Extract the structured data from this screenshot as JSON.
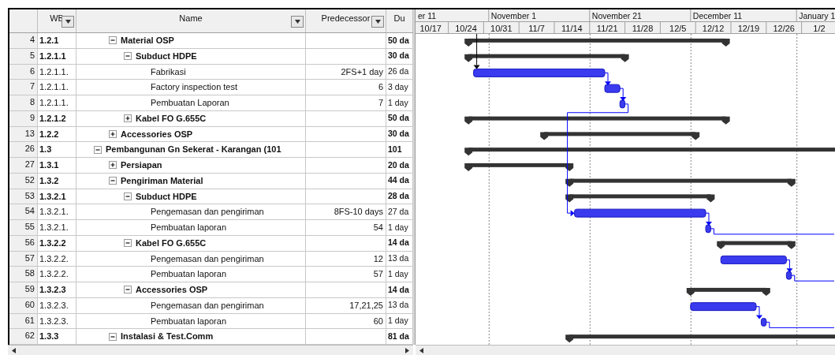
{
  "table": {
    "columns": [
      {
        "label": "WB",
        "filter": true
      },
      {
        "label": "Name",
        "filter": true
      },
      {
        "label": "Predecessor",
        "filter": true
      },
      {
        "label": "Du",
        "filter": false
      }
    ]
  },
  "tasks": [
    {
      "children": [
        {
          "id": "4",
          "wbs": "1.2.1",
          "summary": true,
          "name": "Material OSP",
          "duration": "50 da",
          "expanded": true,
          "children": [
            {
              "id": "5",
              "wbs": "1.2.1.1",
              "summary": true,
              "name": "Subduct HDPE",
              "duration": "30 da",
              "expanded": true,
              "children": [
                {
                  "id": "6",
                  "wbs": "1.2.1.1.",
                  "summary": false,
                  "name": "Fabrikasi",
                  "predecessors": "2FS+1 day",
                  "duration": "26 da"
                },
                {
                  "id": "7",
                  "wbs": "1.2.1.1.",
                  "summary": false,
                  "name": "Factory inspection test",
                  "predecessors": "6",
                  "duration": "3 day"
                },
                {
                  "id": "8",
                  "wbs": "1.2.1.1.",
                  "summary": false,
                  "name": "Pembuatan Laporan",
                  "predecessors": "7",
                  "duration": "1 day"
                }
              ]
            },
            {
              "id": "9",
              "wbs": "1.2.1.2",
              "summary": true,
              "name": "Kabel FO G.655C",
              "duration": "50 da",
              "expanded": false
            }
          ]
        },
        {
          "id": "13",
          "wbs": "1.2.2",
          "summary": true,
          "name": "Accessories OSP",
          "duration": "30 da",
          "expanded": false
        }
      ]
    },
    {
      "id": "26",
      "wbs": "1.3",
      "summary": true,
      "name": "Pembangunan Gn Sekerat - Karangan (101",
      "duration": "101",
      "expanded": true,
      "children": [
        {
          "id": "27",
          "wbs": "1.3.1",
          "summary": true,
          "name": "Persiapan",
          "duration": "20 da",
          "expanded": false
        },
        {
          "id": "52",
          "wbs": "1.3.2",
          "summary": true,
          "name": "Pengiriman Material",
          "duration": "44 da",
          "expanded": true,
          "children": [
            {
              "id": "53",
              "wbs": "1.3.2.1",
              "summary": true,
              "name": "Subduct HDPE",
              "duration": "28 da",
              "expanded": true,
              "children": [
                {
                  "id": "54",
                  "wbs": "1.3.2.1.",
                  "summary": false,
                  "name": "Pengemasan dan pengiriman",
                  "predecessors": "8FS-10 days",
                  "duration": "27 da"
                },
                {
                  "id": "55",
                  "wbs": "1.3.2.1.",
                  "summary": false,
                  "name": "Pembuatan laporan",
                  "predecessors": "54",
                  "duration": "1 day"
                }
              ]
            },
            {
              "id": "56",
              "wbs": "1.3.2.2",
              "summary": true,
              "name": "Kabel FO G.655C",
              "duration": "14 da",
              "expanded": true,
              "children": [
                {
                  "id": "57",
                  "wbs": "1.3.2.2.",
                  "summary": false,
                  "name": "Pengemasan dan pengiriman",
                  "predecessors": "12",
                  "duration": "13 da"
                },
                {
                  "id": "58",
                  "wbs": "1.3.2.2.",
                  "summary": false,
                  "name": "Pembuatan laporan",
                  "predecessors": "57",
                  "duration": "1 day"
                }
              ]
            },
            {
              "id": "59",
              "wbs": "1.3.2.3",
              "summary": true,
              "name": "Accessories OSP",
              "duration": "14 da",
              "expanded": true,
              "children": [
                {
                  "id": "60",
                  "wbs": "1.3.2.3.",
                  "summary": false,
                  "name": "Pengemasan dan pengiriman",
                  "predecessors": "17,21,25",
                  "duration": "13 da"
                },
                {
                  "id": "61",
                  "wbs": "1.3.2.3.",
                  "summary": false,
                  "name": "Pembuatan laporan",
                  "predecessors": "60",
                  "duration": "1 day"
                }
              ]
            }
          ]
        },
        {
          "id": "62",
          "wbs": "1.3.3",
          "summary": true,
          "name": "Instalasi & Test.Comm",
          "duration": "81 da",
          "expanded": true
        }
      ]
    }
  ],
  "gantt": {
    "timescale": {
      "top": [
        "er 11",
        "November 1",
        "November 21",
        "December 11",
        "January 1"
      ],
      "bottom": [
        "10/17",
        "10/24",
        "10/31",
        "11/7",
        "11/14",
        "11/21",
        "11/28",
        "12/5",
        "12/12",
        "12/19",
        "12/26",
        "1/2"
      ]
    }
  }
}
